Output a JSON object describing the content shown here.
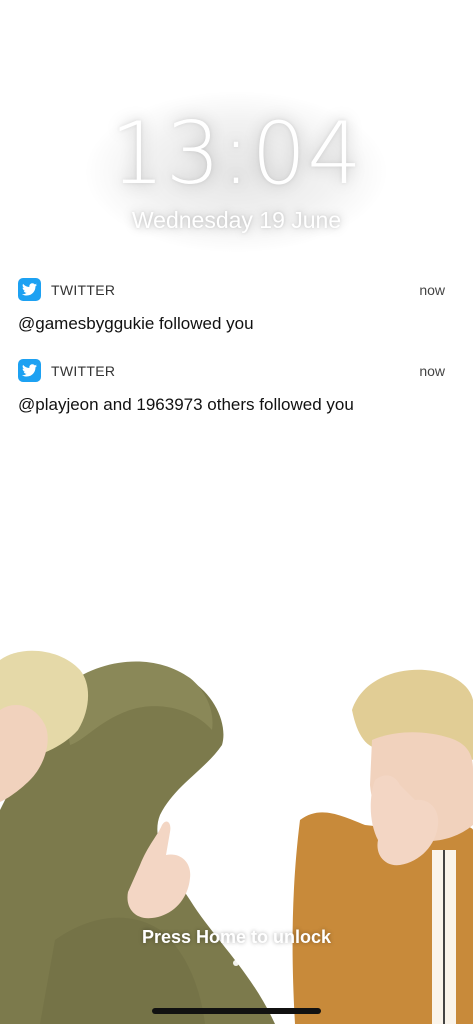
{
  "lockscreen": {
    "time": "13:04",
    "date": "Wednesday 19 June",
    "unlock_hint": "Press Home to unlock"
  },
  "notifications": [
    {
      "app": "TWITTER",
      "icon": "twitter-bird-icon",
      "time": "now",
      "message": "@gamesbyggukie followed you"
    },
    {
      "app": "TWITTER",
      "icon": "twitter-bird-icon",
      "time": "now",
      "message": "@playjeon and 1963973 others followed you"
    }
  ],
  "colors": {
    "twitter_blue": "#1da1f2",
    "background": "#ffffff",
    "text": "#111111"
  }
}
